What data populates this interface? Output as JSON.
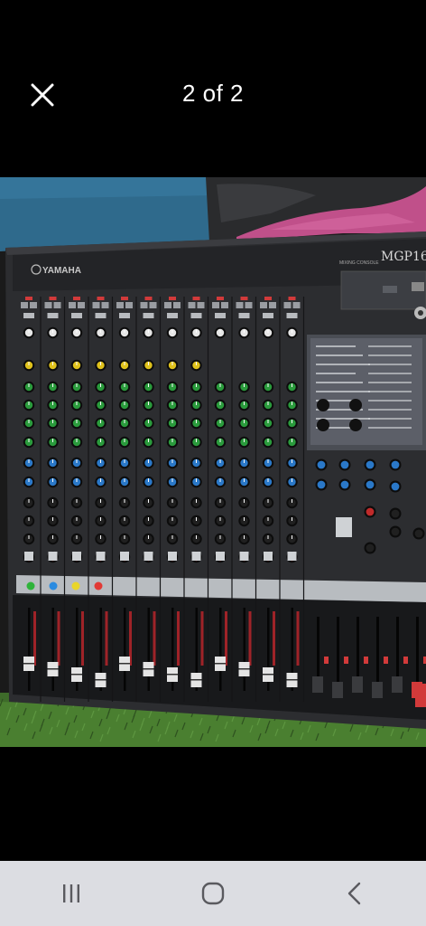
{
  "viewer": {
    "counter": "2 of 2"
  },
  "photo": {
    "brand": "YAMAHA",
    "model": "MGP16",
    "console_label": "MIXING CONSOLE",
    "channel_colors": [
      "#2eb33a",
      "#2a8be0",
      "#e9d52a",
      "#e23a35"
    ]
  },
  "icons": {
    "close": "close-icon",
    "recents": "recents-icon",
    "home": "home-icon",
    "back": "back-icon"
  },
  "colors": {
    "background": "#000000",
    "navbar": "#dcdde2",
    "nav_icon": "#5a5a5f"
  }
}
